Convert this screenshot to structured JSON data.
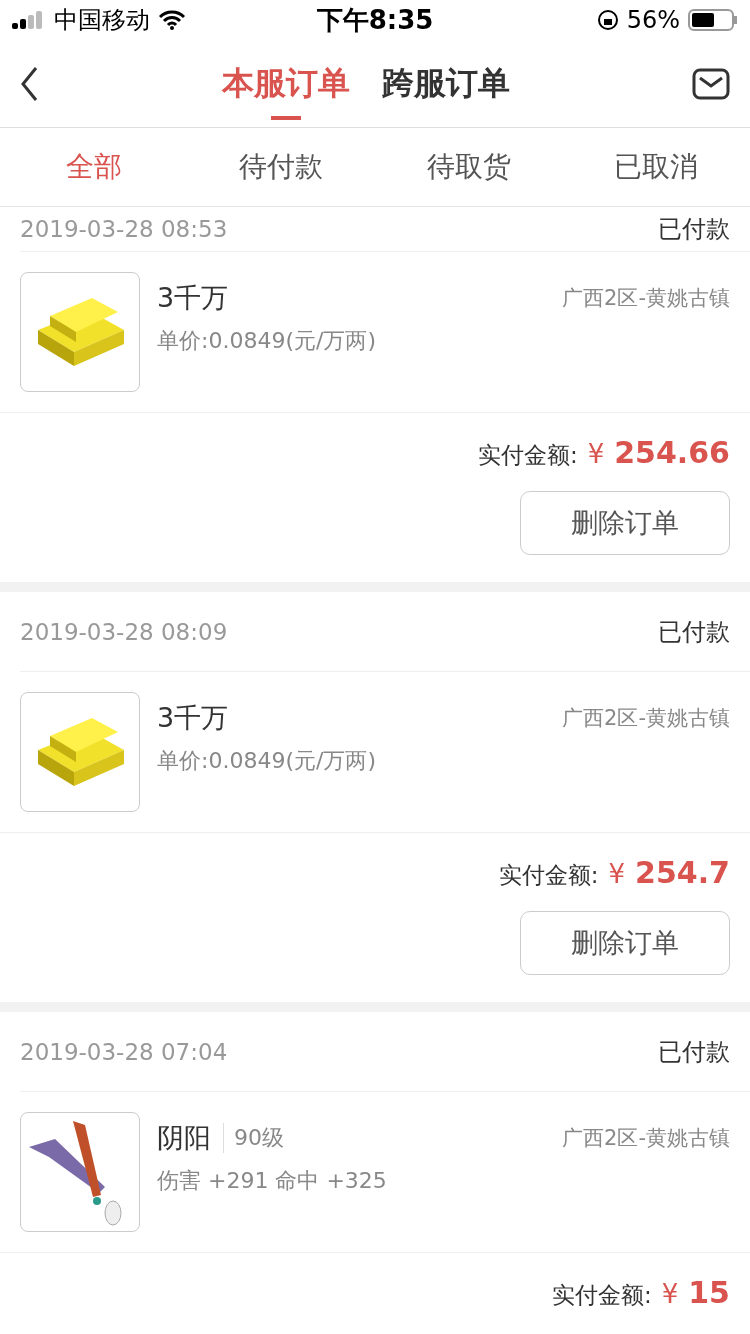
{
  "status_bar": {
    "carrier": "中国移动",
    "time": "下午8:35",
    "battery": "56%"
  },
  "nav": {
    "tabs": [
      {
        "label": "本服订单",
        "selected": true
      },
      {
        "label": "跨服订单",
        "selected": false
      }
    ]
  },
  "filters": [
    {
      "label": "全部",
      "selected": true
    },
    {
      "label": "待付款",
      "selected": false
    },
    {
      "label": "待取货",
      "selected": false
    },
    {
      "label": "已取消",
      "selected": false
    }
  ],
  "orders": [
    {
      "time": "2019-03-28 08:53",
      "status": "已付款",
      "item": {
        "kind": "gold",
        "name": "3千万",
        "detail": "单价:0.0849(元/万两)",
        "server": "广西2区-黄姚古镇"
      },
      "total_label": "实付金额:",
      "currency": "¥",
      "amount": "254.66",
      "action": "删除订单"
    },
    {
      "time": "2019-03-28 08:09",
      "status": "已付款",
      "item": {
        "kind": "gold",
        "name": "3千万",
        "detail": "单价:0.0849(元/万两)",
        "server": "广西2区-黄姚古镇"
      },
      "total_label": "实付金额:",
      "currency": "¥",
      "amount": "254.7",
      "action": "删除订单"
    },
    {
      "time": "2019-03-28 07:04",
      "status": "已付款",
      "item": {
        "kind": "weapon",
        "name": "阴阳",
        "level": "90级",
        "detail": "伤害 +291 命中 +325",
        "server": "广西2区-黄姚古镇"
      },
      "total_label": "实付金额:",
      "currency": "¥",
      "amount": "15"
    }
  ]
}
